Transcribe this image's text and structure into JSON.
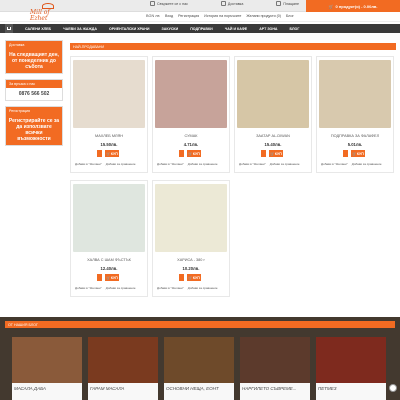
{
  "top": {
    "links": [
      "Свържете се с нас",
      "Доставка",
      "Плащане"
    ],
    "cart": "0 продукт(и) - 0.00лв."
  },
  "sub": {
    "currency": "BGN лв",
    "links": [
      "Вход",
      "Регистрация",
      "История на поръчките",
      "Желани продукти (0)",
      "Блог"
    ]
  },
  "logo": {
    "text": "Mill of Ezhet"
  },
  "nav": [
    "САЛЕНИ ХЛЕБ",
    "ЧАЕВИ ЗА ЖАЖДА",
    "ОРИЕНТАЛСКИ ХРАНИ",
    "ЗАКУСКИ",
    "ПОДПРАВКИ",
    "ЧАЙ И КАФЕ",
    "АРТ ЗОНА",
    "БЛОГ"
  ],
  "sidebar": [
    {
      "title": "Доставка",
      "body": "На следващият ден, от понеделник до събота"
    },
    {
      "title": "За връзка с нас",
      "phone": "0876 566 502"
    },
    {
      "title": "Регистрация",
      "body": "Регистрирайте се за да използвате всички възможности"
    }
  ],
  "main_title": "НАЙ-ПРОДАВАНИ",
  "products": [
    {
      "name": "МАХЛЕБ МЛЯН",
      "price": "15.50лв.",
      "color": "#e6dccf"
    },
    {
      "name": "СУМАК",
      "price": "4.71лв.",
      "color": "#c7a39a"
    },
    {
      "name": "ЗААТАР AL-DIWAN",
      "price": "15.40лв.",
      "color": "#d6c6a6"
    },
    {
      "name": "ПОДПРАВКА ЗА ФАЛАФЕЛ",
      "price": "5.01лв.",
      "color": "#d8c9ae"
    },
    {
      "name": "ХАЛВА С ШАМ ФЪСТЪК",
      "price": "12.40лв.",
      "color": "#dfe6df"
    },
    {
      "name": "ХАРИСА - 380 г",
      "price": "10.20лв.",
      "color": "#ece9d6"
    }
  ],
  "buy_label": "КУП",
  "actions": [
    "Добави в \"Желани\"",
    "Добави за сравнение"
  ],
  "blog": {
    "title": "ОТ НАШИЯ БЛОГ",
    "items": [
      {
        "caption": "МАСАЛА ДАБА",
        "color": "#8a5a3a"
      },
      {
        "caption": "ГАРАМ МАСАЛА",
        "color": "#7a3a1f"
      },
      {
        "caption": "ОСНОВНИ НЕЩА, ЕОНТ",
        "color": "#6e4a2a"
      },
      {
        "caption": "НАРГИЛЕТО СЪВРЕМЕ...",
        "color": "#5c3a2c"
      },
      {
        "caption": "ПЕТМЕЗ",
        "color": "#7e2a1e"
      }
    ]
  }
}
